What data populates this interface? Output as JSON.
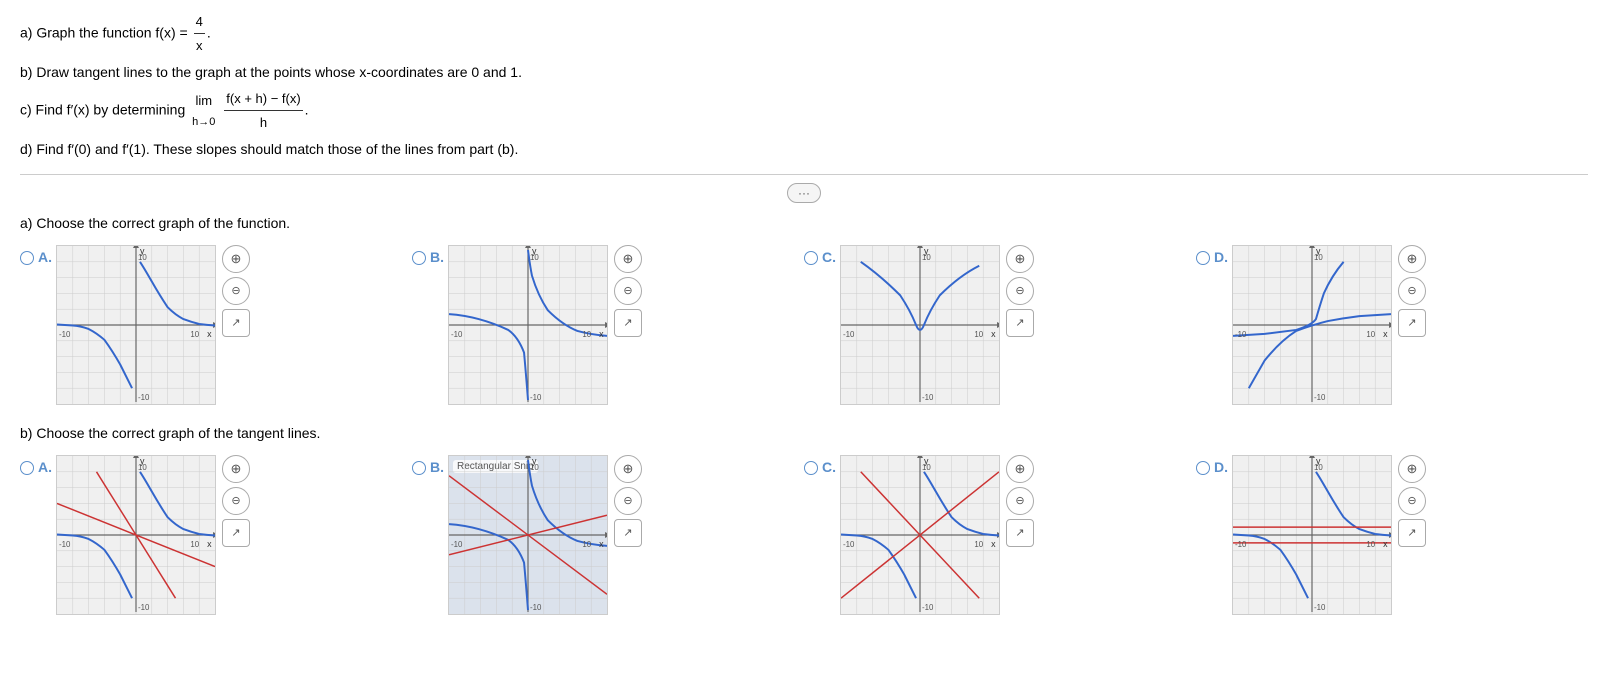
{
  "problem": {
    "part_a": "a) Graph the function f(x) =",
    "func": "4/x",
    "func_num": "4",
    "func_denom": "x",
    "part_b": "b) Draw tangent lines to the graph at the points whose x-coordinates are 0 and 1.",
    "part_c_pre": "c) Find f′(x) by determining",
    "limit_base": "lim",
    "limit_sub": "h→0",
    "limit_expr_num": "f(x + h) − f(x)",
    "limit_expr_denom": "h",
    "part_d": "d) Find f′(0) and f′(1). These slopes should match those of the lines from part (b).",
    "ellipsis": "···"
  },
  "section_a": {
    "label": "a) Choose the correct graph of the function.",
    "options": [
      {
        "id": "A",
        "letter": "A."
      },
      {
        "id": "B",
        "letter": "B."
      },
      {
        "id": "C",
        "letter": "C."
      },
      {
        "id": "D",
        "letter": "D."
      }
    ]
  },
  "section_b": {
    "label": "b) Choose the correct graph of the tangent lines.",
    "options": [
      {
        "id": "A",
        "letter": "A."
      },
      {
        "id": "B",
        "letter": "B."
      },
      {
        "id": "C",
        "letter": "C."
      },
      {
        "id": "D",
        "letter": "D."
      }
    ]
  },
  "icons": {
    "zoom_in": "🔍",
    "zoom_out": "🔍",
    "external": "↗"
  }
}
